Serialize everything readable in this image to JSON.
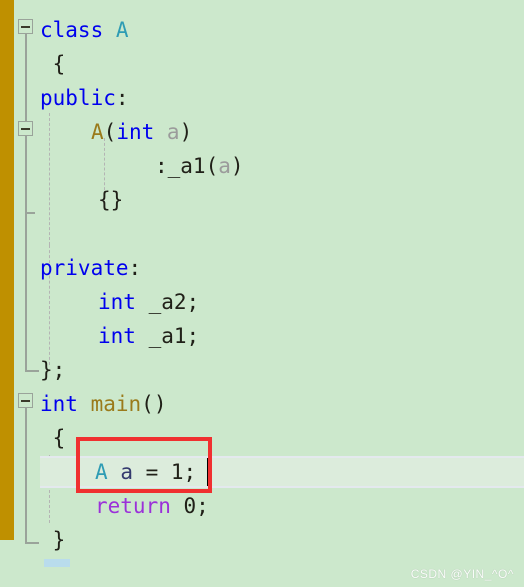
{
  "editor": {
    "background_color": "#cce8cc",
    "change_bar_color": "#bf9000",
    "current_line_color": "#dcecdc",
    "annotation_box_color": "#f03030"
  },
  "code_lines": [
    {
      "index": 1,
      "text": "class A",
      "tokens": [
        {
          "t": "class",
          "cls": "t-keyword"
        },
        {
          "t": " ",
          "cls": "t-plain"
        },
        {
          "t": "A",
          "cls": "t-type"
        }
      ]
    },
    {
      "index": 2,
      "text": "{",
      "tokens": [
        {
          "t": " {",
          "cls": "t-plain"
        }
      ]
    },
    {
      "index": 3,
      "text": "public:",
      "tokens": [
        {
          "t": "public",
          "cls": "t-keyword"
        },
        {
          "t": ":",
          "cls": "t-plain"
        }
      ]
    },
    {
      "index": 4,
      "text": "    A(int a)",
      "tokens": [
        {
          "t": "A",
          "cls": "t-func"
        },
        {
          "t": "(",
          "cls": "t-plain"
        },
        {
          "t": "int",
          "cls": "t-keyword"
        },
        {
          "t": " ",
          "cls": "t-plain"
        },
        {
          "t": "a",
          "cls": "t-param"
        },
        {
          "t": ")",
          "cls": "t-plain"
        }
      ]
    },
    {
      "index": 5,
      "text": "        :_a1(a)",
      "tokens": [
        {
          "t": ":_a1",
          "cls": "t-plain"
        },
        {
          "t": "(",
          "cls": "t-plain"
        },
        {
          "t": "a",
          "cls": "t-param"
        },
        {
          "t": ")",
          "cls": "t-plain"
        }
      ]
    },
    {
      "index": 6,
      "text": "    {}",
      "tokens": [
        {
          "t": "{}",
          "cls": "t-plain"
        }
      ]
    },
    {
      "index": 7,
      "text": "",
      "tokens": []
    },
    {
      "index": 8,
      "text": "private:",
      "tokens": [
        {
          "t": "private",
          "cls": "t-keyword"
        },
        {
          "t": ":",
          "cls": "t-plain"
        }
      ]
    },
    {
      "index": 9,
      "text": "    int _a2;",
      "tokens": [
        {
          "t": "int",
          "cls": "t-keyword"
        },
        {
          "t": " _a2;",
          "cls": "t-plain"
        }
      ]
    },
    {
      "index": 10,
      "text": "    int _a1;",
      "tokens": [
        {
          "t": "int",
          "cls": "t-keyword"
        },
        {
          "t": " _a1;",
          "cls": "t-plain"
        }
      ]
    },
    {
      "index": 11,
      "text": "};",
      "tokens": [
        {
          "t": "};",
          "cls": "t-plain"
        }
      ]
    },
    {
      "index": 12,
      "text": "int main()",
      "tokens": [
        {
          "t": "int",
          "cls": "t-keyword"
        },
        {
          "t": " ",
          "cls": "t-plain"
        },
        {
          "t": "main",
          "cls": "t-func"
        },
        {
          "t": "()",
          "cls": "t-plain"
        }
      ]
    },
    {
      "index": 13,
      "text": "{",
      "tokens": [
        {
          "t": " {",
          "cls": "t-plain"
        }
      ]
    },
    {
      "index": 14,
      "text": "    A a = 1;",
      "tokens": [
        {
          "t": "A",
          "cls": "t-type"
        },
        {
          "t": " ",
          "cls": "t-plain"
        },
        {
          "t": "a",
          "cls": "t-var"
        },
        {
          "t": " = 1;",
          "cls": "t-plain"
        }
      ]
    },
    {
      "index": 15,
      "text": "    return 0;",
      "tokens": [
        {
          "t": "return",
          "cls": "t-return"
        },
        {
          "t": " 0;",
          "cls": "t-plain"
        }
      ]
    },
    {
      "index": 16,
      "text": "}",
      "tokens": [
        {
          "t": " }",
          "cls": "t-plain"
        }
      ]
    }
  ],
  "fold_markers": [
    {
      "name": "fold-marker-class-a",
      "line": 1,
      "state": "expanded"
    },
    {
      "name": "fold-marker-constructor",
      "line": 4,
      "state": "expanded"
    },
    {
      "name": "fold-marker-main",
      "line": 12,
      "state": "expanded"
    }
  ],
  "annotation": {
    "name": "red-highlight-box",
    "target_line_text": "A a = 1;",
    "color": "#f03030"
  },
  "current_line": {
    "line": 14,
    "text": "A a = 1;"
  },
  "watermark": {
    "text": "CSDN @YIN_^O^"
  }
}
